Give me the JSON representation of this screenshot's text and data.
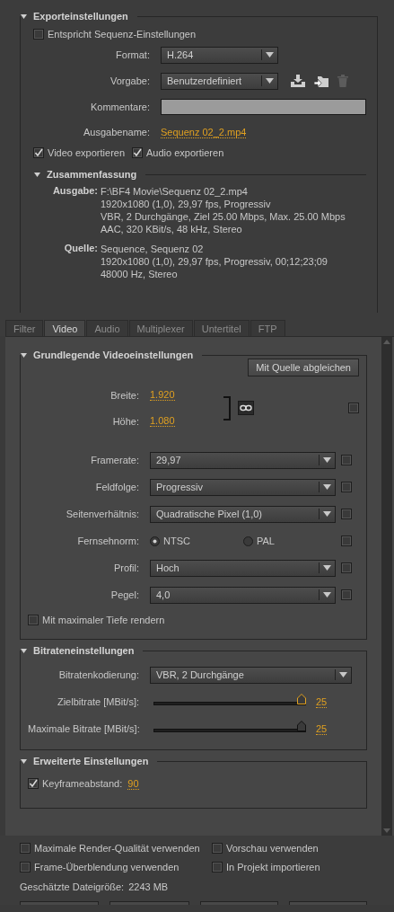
{
  "export_settings": {
    "title": "Exporteinstellungen",
    "expanded": true,
    "match_sequence": {
      "label": "Entspricht Sequenz-Einstellungen",
      "checked": false
    },
    "format": {
      "label": "Format:",
      "value": "H.264"
    },
    "preset": {
      "label": "Vorgabe:",
      "value": "Benutzerdefiniert"
    },
    "comments": {
      "label": "Kommentare:"
    },
    "output_name": {
      "label": "Ausgabename:",
      "value": "Sequenz 02_2.mp4"
    },
    "export_options": [
      {
        "label": "Video exportieren",
        "checked": true
      },
      {
        "label": "Audio exportieren",
        "checked": true
      }
    ],
    "summary": {
      "title": "Zusammenfassung",
      "expanded": true,
      "entries": [
        {
          "label": "Ausgabe:",
          "lines": [
            "F:\\BF4 Movie\\Sequenz 02_2.mp4",
            "1920x1080 (1,0), 29,97 fps, Progressiv",
            "VBR, 2 Durchgänge, Ziel 25.00 Mbps, Max. 25.00 Mbps",
            "AAC, 320 KBit/s, 48 kHz, Stereo"
          ]
        },
        {
          "label": "Quelle:",
          "lines": [
            "Sequence, Sequenz 02",
            "1920x1080 (1,0), 29,97 fps, Progressiv, 00;12;23;09",
            "48000 Hz, Stereo"
          ]
        }
      ]
    }
  },
  "tabs": [
    {
      "label": "Filter",
      "selected": false
    },
    {
      "label": "Video",
      "selected": true
    },
    {
      "label": "Audio",
      "selected": false
    },
    {
      "label": "Multiplexer",
      "selected": false
    },
    {
      "label": "Untertitel",
      "selected": false
    },
    {
      "label": "FTP",
      "selected": false
    }
  ],
  "video_groups": [
    {
      "title": "Grundlegende Videoeinstellungen",
      "expanded": true,
      "button": "Mit Quelle abgleichen",
      "rows": [
        {
          "kind": "dims",
          "width": {
            "label": "Breite:",
            "value": "1.920"
          },
          "height": {
            "label": "Höhe:",
            "value": "1.080"
          },
          "checked": false
        },
        {
          "kind": "select",
          "label": "Framerate:",
          "value": "29,97",
          "checked": false
        },
        {
          "kind": "select",
          "label": "Feldfolge:",
          "value": "Progressiv",
          "checked": false
        },
        {
          "kind": "select",
          "label": "Seitenverhältnis:",
          "value": "Quadratische Pixel (1,0)",
          "checked": false
        },
        {
          "kind": "radio",
          "label": "Fernsehnorm:",
          "options": [
            {
              "label": "NTSC",
              "selected": true
            },
            {
              "label": "PAL",
              "selected": false
            }
          ],
          "checked": false
        },
        {
          "kind": "select",
          "label": "Profil:",
          "value": "Hoch",
          "checked": false
        },
        {
          "kind": "select",
          "label": "Pegel:",
          "value": "4,0",
          "checked": false
        },
        {
          "kind": "check",
          "label": "Mit maximaler Tiefe rendern",
          "checked": false
        }
      ]
    },
    {
      "title": "Bitrateneinstellungen",
      "expanded": true,
      "rows": [
        {
          "kind": "wideselect",
          "label": "Bitratenkodierung:",
          "value": "VBR, 2 Durchgänge"
        },
        {
          "kind": "slider",
          "label": "Zielbitrate [MBit/s]:",
          "level": 0.97,
          "focused": true,
          "value": "25"
        },
        {
          "kind": "slider",
          "label": "Maximale Bitrate [MBit/s]:",
          "level": 0.97,
          "focused": false,
          "value": "25"
        }
      ]
    },
    {
      "title": "Erweiterte Einstellungen",
      "expanded": true,
      "rows": [
        {
          "kind": "keyframe",
          "label": "Keyframeabstand:",
          "checked": true,
          "value": "90"
        }
      ]
    }
  ],
  "footer": {
    "options": [
      {
        "label": "Maximale Render-Qualität verwenden",
        "checked": false
      },
      {
        "label": "Vorschau verwenden",
        "checked": false
      },
      {
        "label": "Frame-Überblendung verwenden",
        "checked": false
      },
      {
        "label": "In Projekt importieren",
        "checked": false
      }
    ],
    "file_size": {
      "label": "Geschätzte Dateigröße:",
      "value": "2243 MB"
    }
  }
}
